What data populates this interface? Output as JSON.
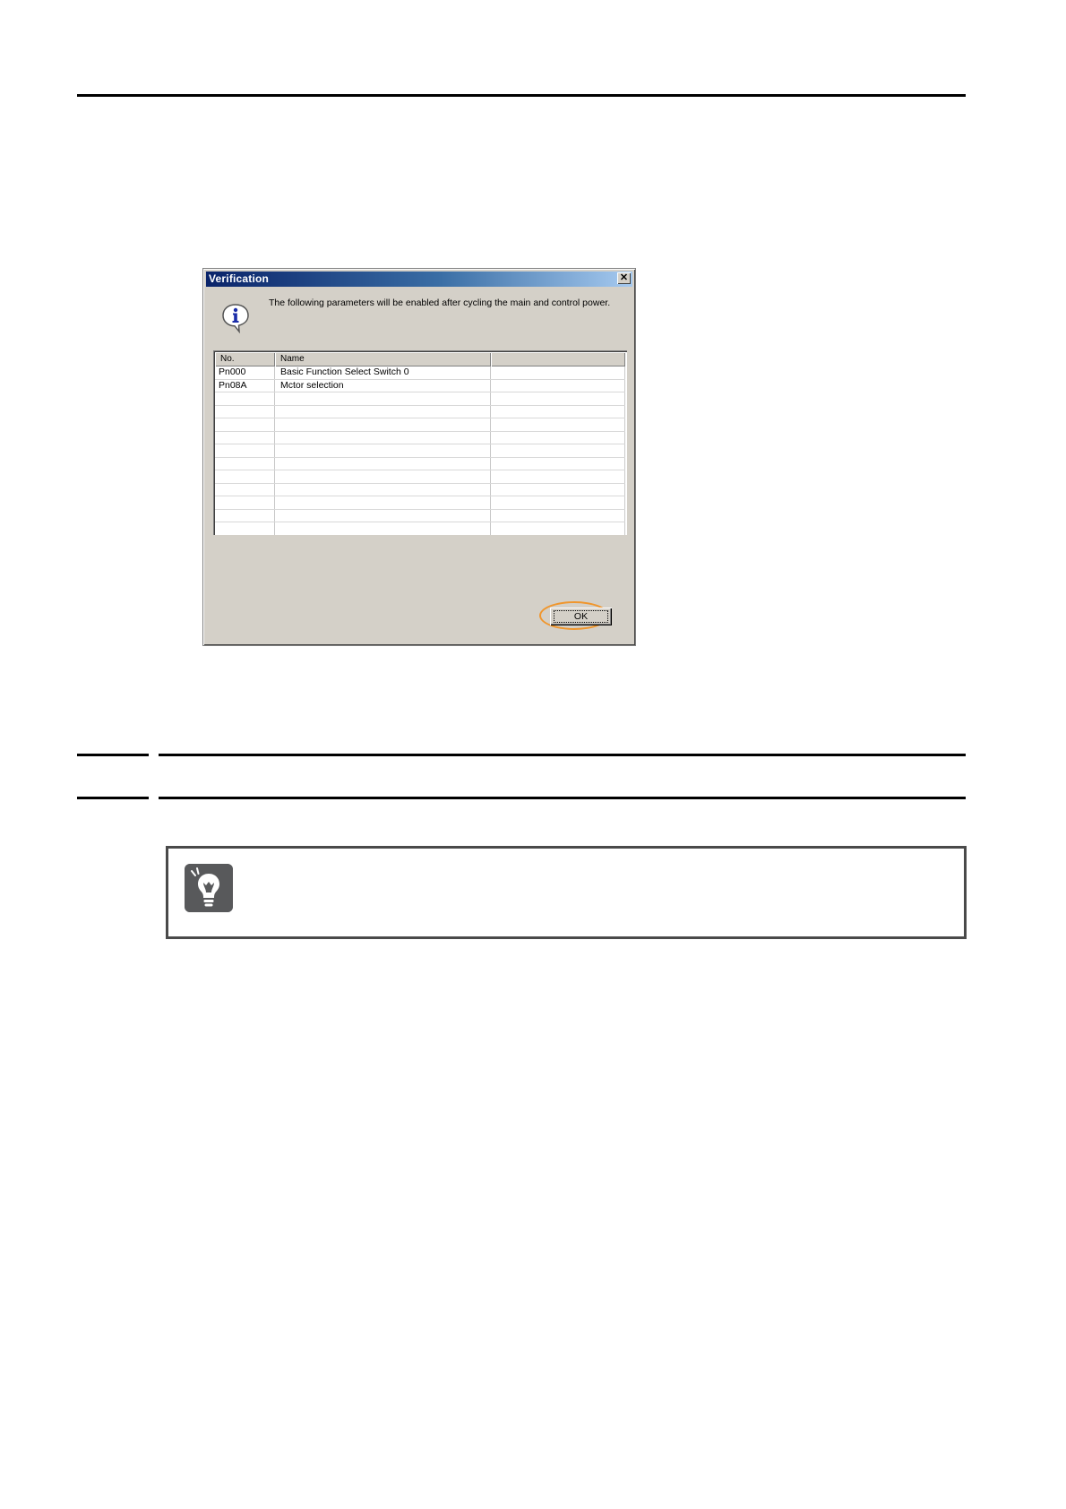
{
  "dialog": {
    "title": "Verification",
    "close_glyph": "✕",
    "message": "The following parameters will be enabled after cycling the main and control power.",
    "icon": "info-icon",
    "columns": [
      "No.",
      "Name",
      ""
    ],
    "rows": [
      {
        "no": "Pn000",
        "name": "Basic Function Select Switch 0",
        "extra": ""
      },
      {
        "no": "Pn08A",
        "name": "Mctor selection",
        "extra": ""
      }
    ],
    "empty_rows": 11,
    "ok_label": "OK",
    "highlight_color": "#f0962d"
  },
  "note": {
    "icon": "lightbulb-icon"
  }
}
